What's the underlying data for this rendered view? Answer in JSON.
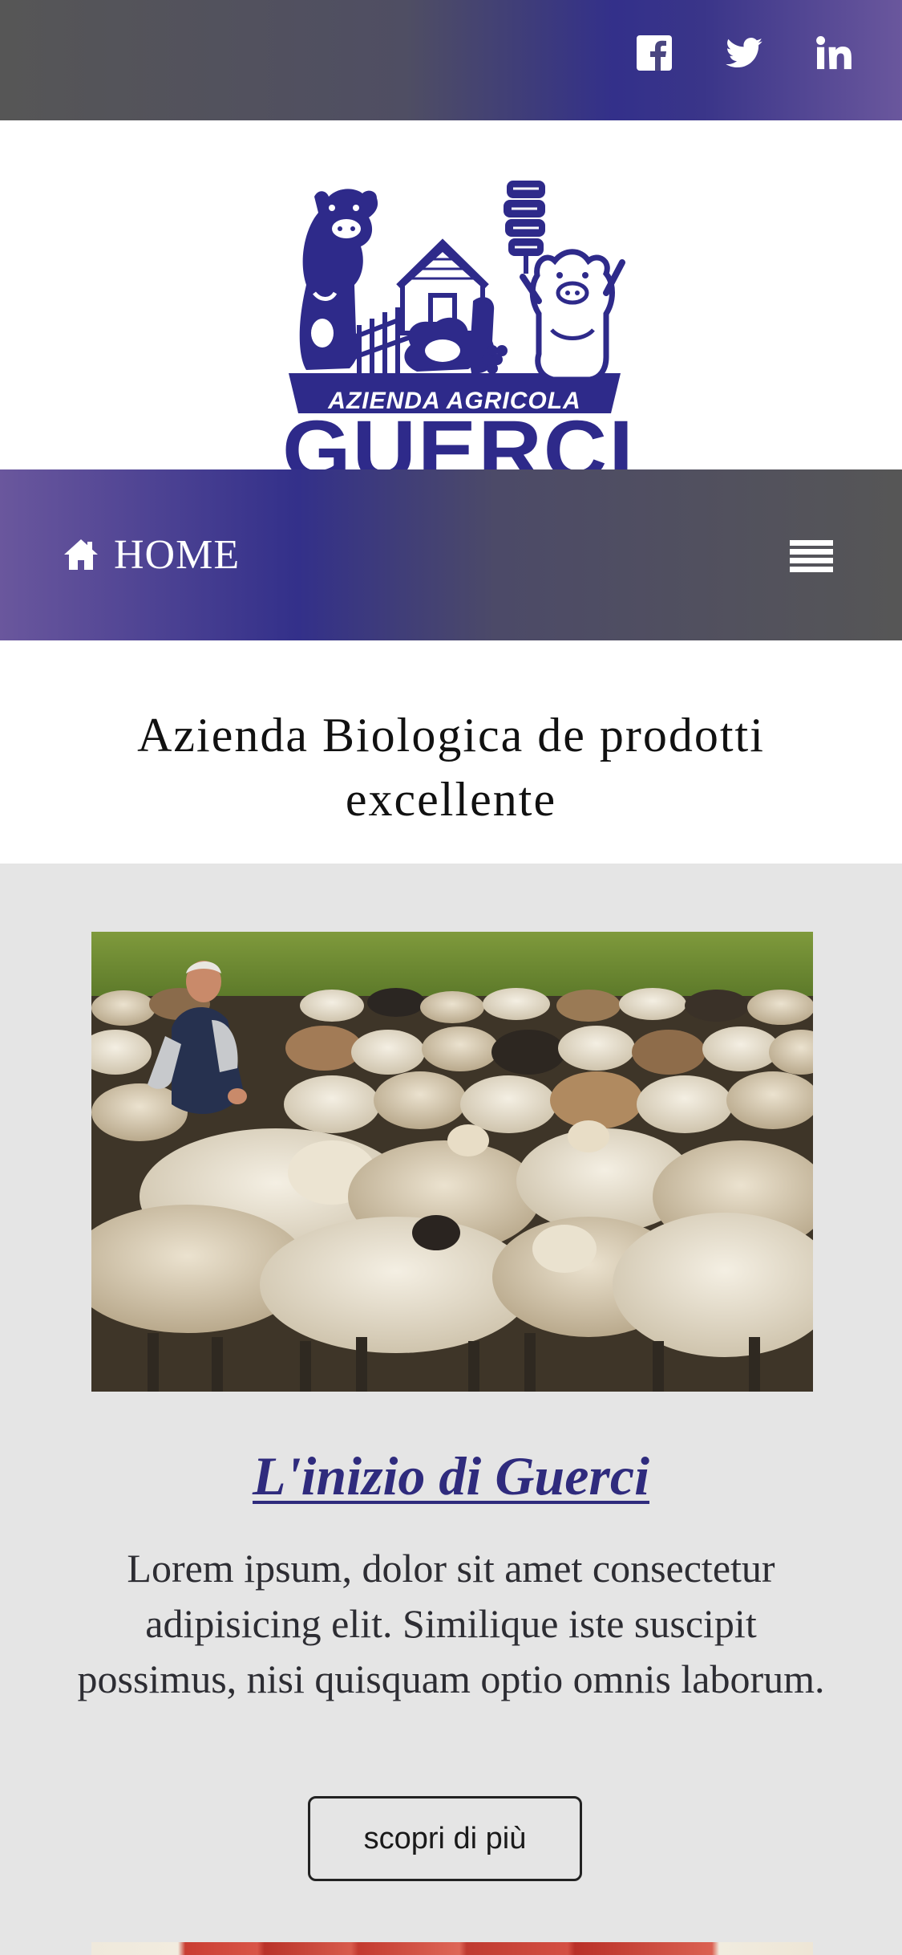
{
  "social": {
    "facebook_icon": "facebook-icon",
    "twitter_icon": "twitter-icon",
    "linkedin_icon": "linkedin-icon"
  },
  "logo": {
    "line1": "AZIENDA AGRICOLA",
    "line2": "GUERCI"
  },
  "nav": {
    "home_label": "HOME",
    "home_icon": "home-icon",
    "menu_icon": "hamburger-menu-icon"
  },
  "tagline": "Azienda Biologica de prodotti excellente",
  "article": {
    "title": "L'inizio di Guerci",
    "body": "Lorem ipsum, dolor sit amet consectetur adipisicing elit. Similique iste suscipit possimus, nisi quisquam optio omnis laborum.",
    "button_label": "scopri di più"
  },
  "colors": {
    "brand_purple": "#2e2a8a",
    "gray": "#565656",
    "light_purple": "#6a579d",
    "content_bg": "#e5e5e5"
  }
}
